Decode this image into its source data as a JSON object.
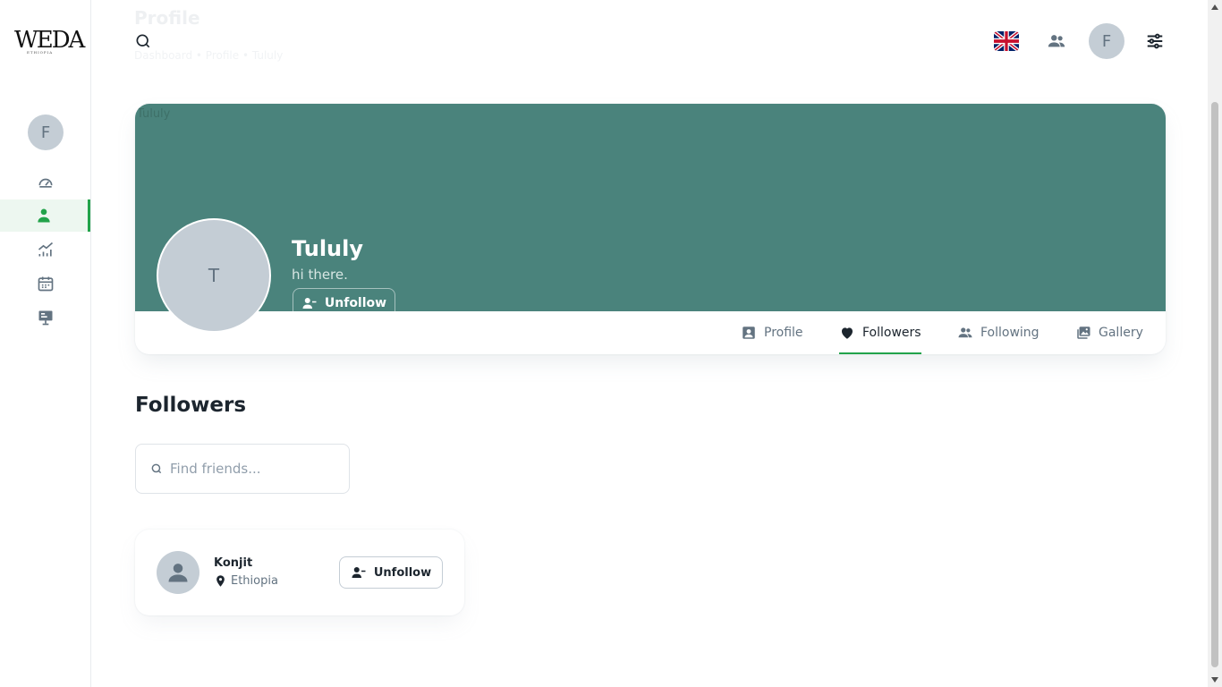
{
  "app": {
    "logo_text": "WEDA",
    "logo_sub": "ETHIOPIA"
  },
  "header": {
    "page_title": "Profile",
    "breadcrumb": "Dashboard  •  Profile  •  Tululy",
    "user_avatar_letter": "F",
    "language_flag": "uk-flag-icon"
  },
  "sidebar": {
    "avatar_letter": "F",
    "items": [
      {
        "icon": "dashboard-icon",
        "active": false
      },
      {
        "icon": "user-icon",
        "active": true
      },
      {
        "icon": "analytics-icon",
        "active": false
      },
      {
        "icon": "calendar-icon",
        "active": false
      },
      {
        "icon": "presentation-icon",
        "active": false
      }
    ]
  },
  "profile": {
    "cover_alt": "Tululy",
    "avatar_letter": "T",
    "name": "Tululy",
    "bio": "hi there.",
    "unfollow_label": "Unfollow",
    "tabs": [
      {
        "label": "Profile",
        "icon": "profile-card-icon",
        "active": false
      },
      {
        "label": "Followers",
        "icon": "heart-icon",
        "active": true
      },
      {
        "label": "Following",
        "icon": "users-icon",
        "active": false
      },
      {
        "label": "Gallery",
        "icon": "gallery-icon",
        "active": false
      }
    ]
  },
  "followers": {
    "title": "Followers",
    "search_placeholder": "Find friends...",
    "items": [
      {
        "name": "Konjit",
        "location": "Ethiopia",
        "button_label": "Unfollow"
      }
    ]
  },
  "colors": {
    "accent": "#22a34a",
    "cover": "#4a837c",
    "avatar_bg": "#c4cdd5"
  }
}
